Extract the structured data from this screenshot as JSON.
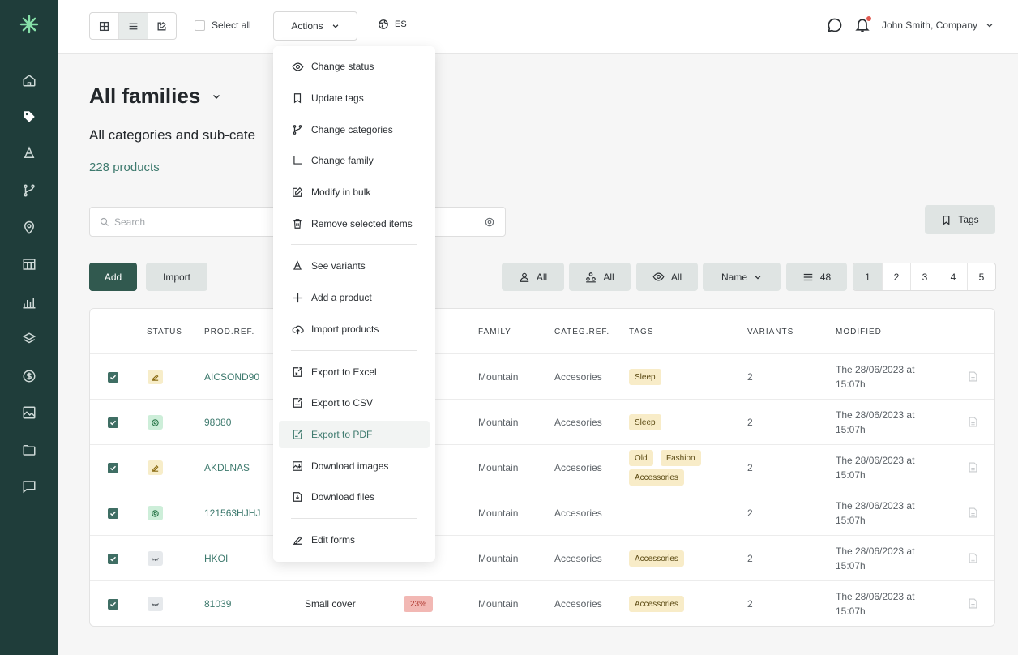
{
  "topbar": {
    "select_all_label": "Select all",
    "actions_label": "Actions",
    "language": "ES",
    "user_name": "John Smith, Company"
  },
  "header": {
    "title": "All families",
    "subtitle": "All categories and sub-cate",
    "product_count": "228 products"
  },
  "search": {
    "placeholder": "Search"
  },
  "toolbar": {
    "tags_label": "Tags",
    "add_label": "Add",
    "import_label": "Import",
    "filter_users": "All",
    "filter_groups": "All",
    "filter_visibility": "All",
    "sort_label": "Name",
    "per_page": "48",
    "pages": [
      "1",
      "2",
      "3",
      "4",
      "5"
    ],
    "active_page": "1"
  },
  "actions_menu": {
    "items": [
      {
        "label": "Change status",
        "icon": "eye-icon"
      },
      {
        "label": "Update tags",
        "icon": "bookmark-icon"
      },
      {
        "label": "Change categories",
        "icon": "branch-icon"
      },
      {
        "label": "Change family",
        "icon": "corner-icon"
      },
      {
        "label": "Modify in bulk",
        "icon": "edit-square-icon"
      },
      {
        "label": "Remove selected items",
        "icon": "trash-icon"
      },
      {
        "label": "See variants",
        "icon": "variants-icon"
      },
      {
        "label": "Add a product",
        "icon": "plus-icon"
      },
      {
        "label": "Import products",
        "icon": "cloud-upload-icon"
      },
      {
        "label": "Export to Excel",
        "icon": "export-file-icon"
      },
      {
        "label": "Export to CSV",
        "icon": "export-file-icon"
      },
      {
        "label": "Export to PDF",
        "icon": "export-file-icon"
      },
      {
        "label": "Download images",
        "icon": "image-download-icon"
      },
      {
        "label": "Download files",
        "icon": "file-download-icon"
      },
      {
        "label": "Edit forms",
        "icon": "pencil-icon"
      }
    ],
    "highlighted": "Export to PDF"
  },
  "table": {
    "columns": {
      "status": "STATUS",
      "prod_ref": "PROD.REF.",
      "family": "FAMILY",
      "categ_ref": "CATEG.REF.",
      "tags": "TAGS",
      "variants": "VARIANTS",
      "modified": "MODIFIED"
    },
    "rows": [
      {
        "status": "edit",
        "ref": "AICSOND90",
        "name": "",
        "pct": "",
        "family": "Mountain",
        "category": "Accesories",
        "tags": [
          "Sleep"
        ],
        "variants": "2",
        "modified": "The 28/06/2023 at 15:07h"
      },
      {
        "status": "view",
        "ref": "98080",
        "name": "",
        "pct": "",
        "family": "Mountain",
        "category": "Accesories",
        "tags": [
          "Sleep"
        ],
        "variants": "2",
        "modified": "The 28/06/2023 at 15:07h"
      },
      {
        "status": "edit",
        "ref": "AKDLNAS",
        "name": "",
        "pct": "",
        "family": "Mountain",
        "category": "Accesories",
        "tags": [
          "Old",
          "Fashion",
          "Accessories"
        ],
        "variants": "2",
        "modified": "The 28/06/2023 at 15:07h"
      },
      {
        "status": "view",
        "ref": "121563HJHJ",
        "name": "",
        "pct": "",
        "family": "Mountain",
        "category": "Accesories",
        "tags": [],
        "variants": "2",
        "modified": "The 28/06/2023 at 15:07h"
      },
      {
        "status": "hidden",
        "ref": "HKOI",
        "name": "",
        "pct": "",
        "family": "Mountain",
        "category": "Accesories",
        "tags": [
          "Accessories"
        ],
        "variants": "2",
        "modified": "The 28/06/2023 at 15:07h"
      },
      {
        "status": "hidden",
        "ref": "81039",
        "name": "Small cover",
        "pct": "23%",
        "family": "Mountain",
        "category": "Accesories",
        "tags": [
          "Accessories"
        ],
        "variants": "2",
        "modified": "The 28/06/2023 at 15:07h"
      }
    ]
  },
  "colors": {
    "sidebar": "#1f3d3a",
    "accent": "#3e7a6e",
    "primary_button": "#31594f",
    "tag_bg": "#f8ecc8",
    "percent_badge": "#f2b8b4"
  }
}
